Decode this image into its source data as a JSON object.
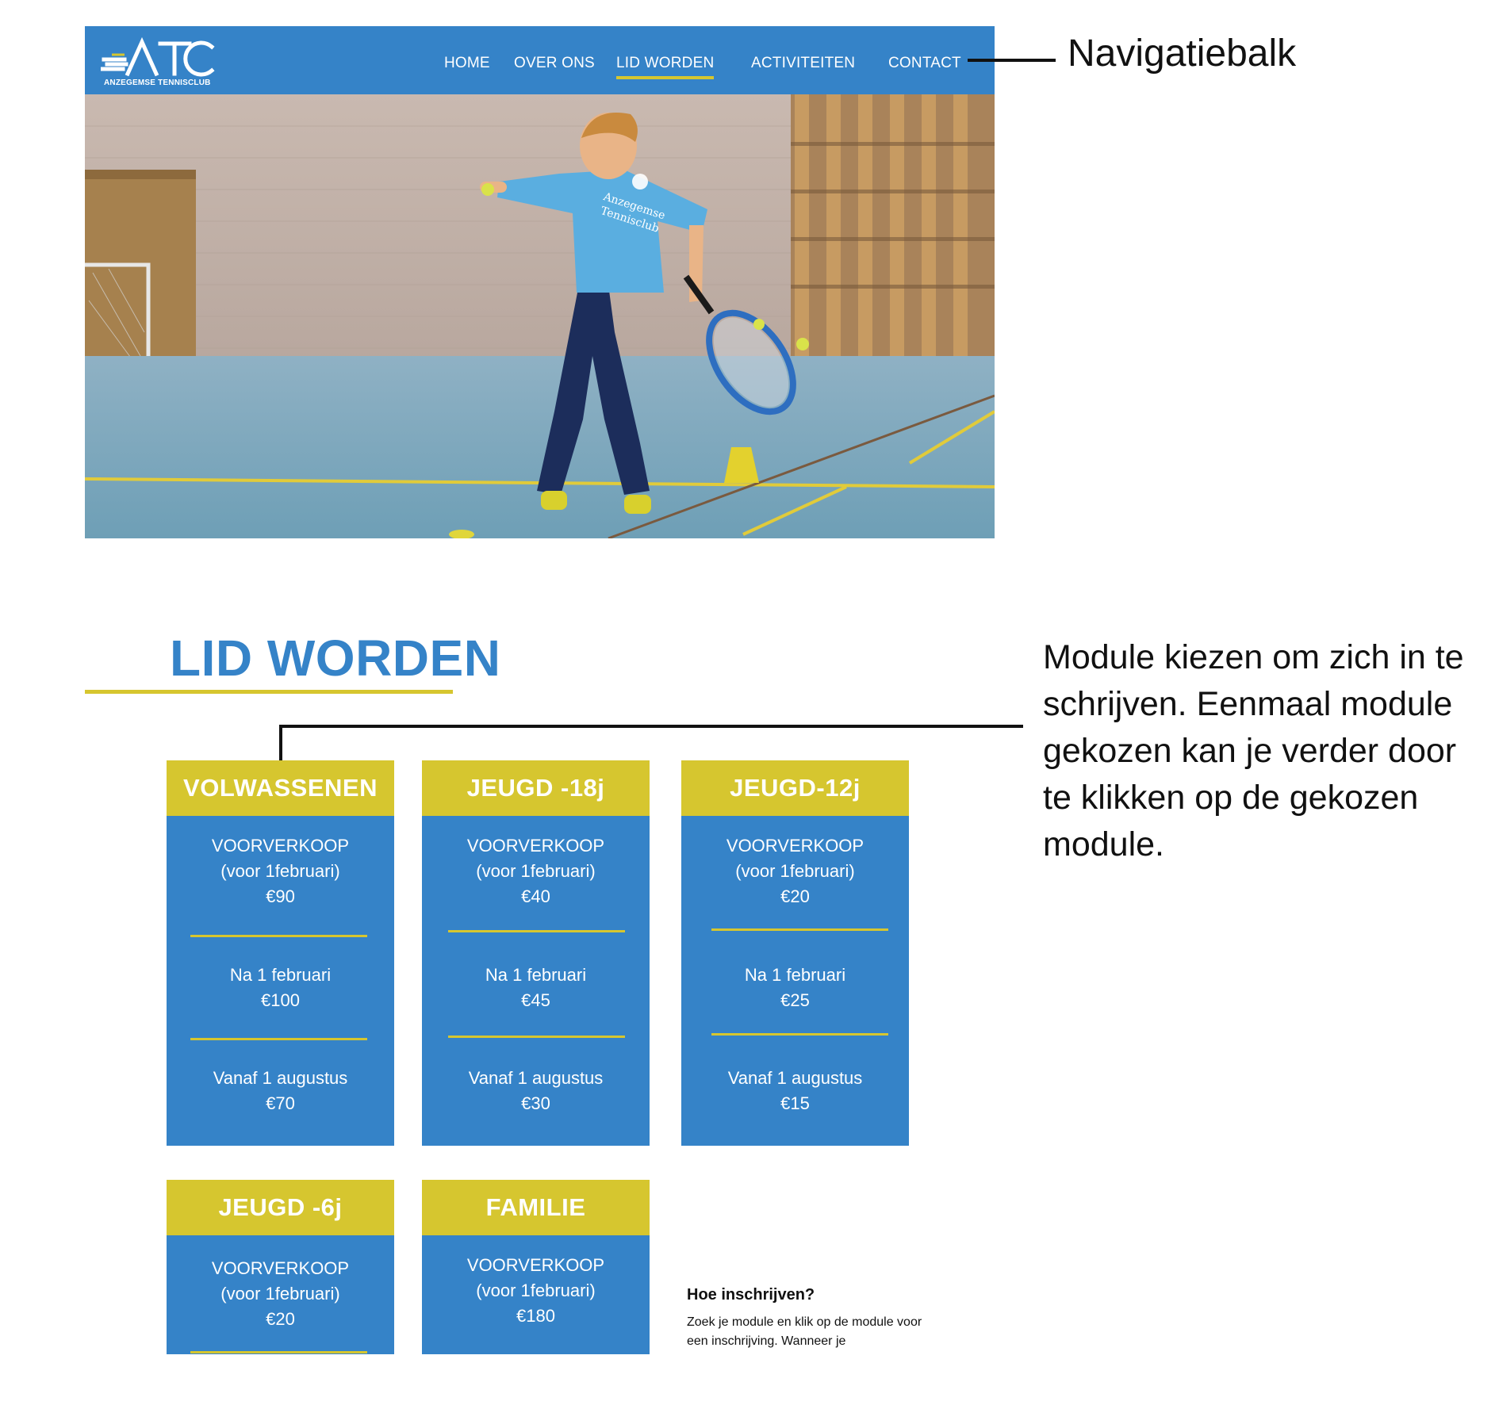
{
  "nav": {
    "logo_text": "ATC",
    "logo_subtitle": "ANZEGEMSE TENNISCLUB",
    "items": [
      {
        "label": "HOME"
      },
      {
        "label": "OVER ONS"
      },
      {
        "label": "LID WORDEN",
        "active": true
      },
      {
        "label": "ACTIVITEITEN"
      },
      {
        "label": "CONTACT"
      }
    ]
  },
  "hero": {
    "shirt_text_1": "Anzegemse",
    "shirt_text_2": "Tennisclub"
  },
  "section": {
    "title": "LID WORDEN"
  },
  "cards": [
    {
      "title": "VOLWASSENEN",
      "blocks": [
        {
          "lines": [
            "VOORVERKOOP",
            "(voor 1februari)",
            "€90"
          ]
        },
        {
          "lines": [
            "Na 1 februari",
            "€100"
          ]
        },
        {
          "lines": [
            "Vanaf 1 augustus",
            "€70"
          ]
        }
      ]
    },
    {
      "title": "JEUGD -18j",
      "blocks": [
        {
          "lines": [
            "VOORVERKOOP",
            "(voor 1februari)",
            "€40"
          ]
        },
        {
          "lines": [
            "Na 1 februari",
            "€45"
          ]
        },
        {
          "lines": [
            "Vanaf 1 augustus",
            "€30"
          ]
        }
      ]
    },
    {
      "title": "JEUGD-12j",
      "blocks": [
        {
          "lines": [
            "VOORVERKOOP",
            "(voor 1februari)",
            "€20"
          ]
        },
        {
          "lines": [
            "Na 1 februari",
            "€25"
          ]
        },
        {
          "lines": [
            "Vanaf 1 augustus",
            "€15"
          ]
        }
      ]
    },
    {
      "title": "JEUGD -6j",
      "blocks": [
        {
          "lines": [
            "VOORVERKOOP",
            "(voor 1februari)",
            "€20"
          ]
        }
      ]
    },
    {
      "title": "FAMILIE",
      "blocks": [
        {
          "lines": [
            "VOORVERKOOP",
            "(voor 1februari)",
            "€180"
          ]
        }
      ]
    }
  ],
  "how": {
    "title": "Hoe inschrijven?",
    "text": "Zoek je module en klik op de module voor een inschrijving. Wanneer je"
  },
  "annotations": {
    "nav": "Navigatiebalk",
    "module": "Module kiezen om zich in te schrijven. Eenmaal module gekozen kan je verder door te klikken op de gekozen module."
  },
  "colors": {
    "brand_blue": "#3583c8",
    "accent_yellow": "#d6c62f"
  }
}
